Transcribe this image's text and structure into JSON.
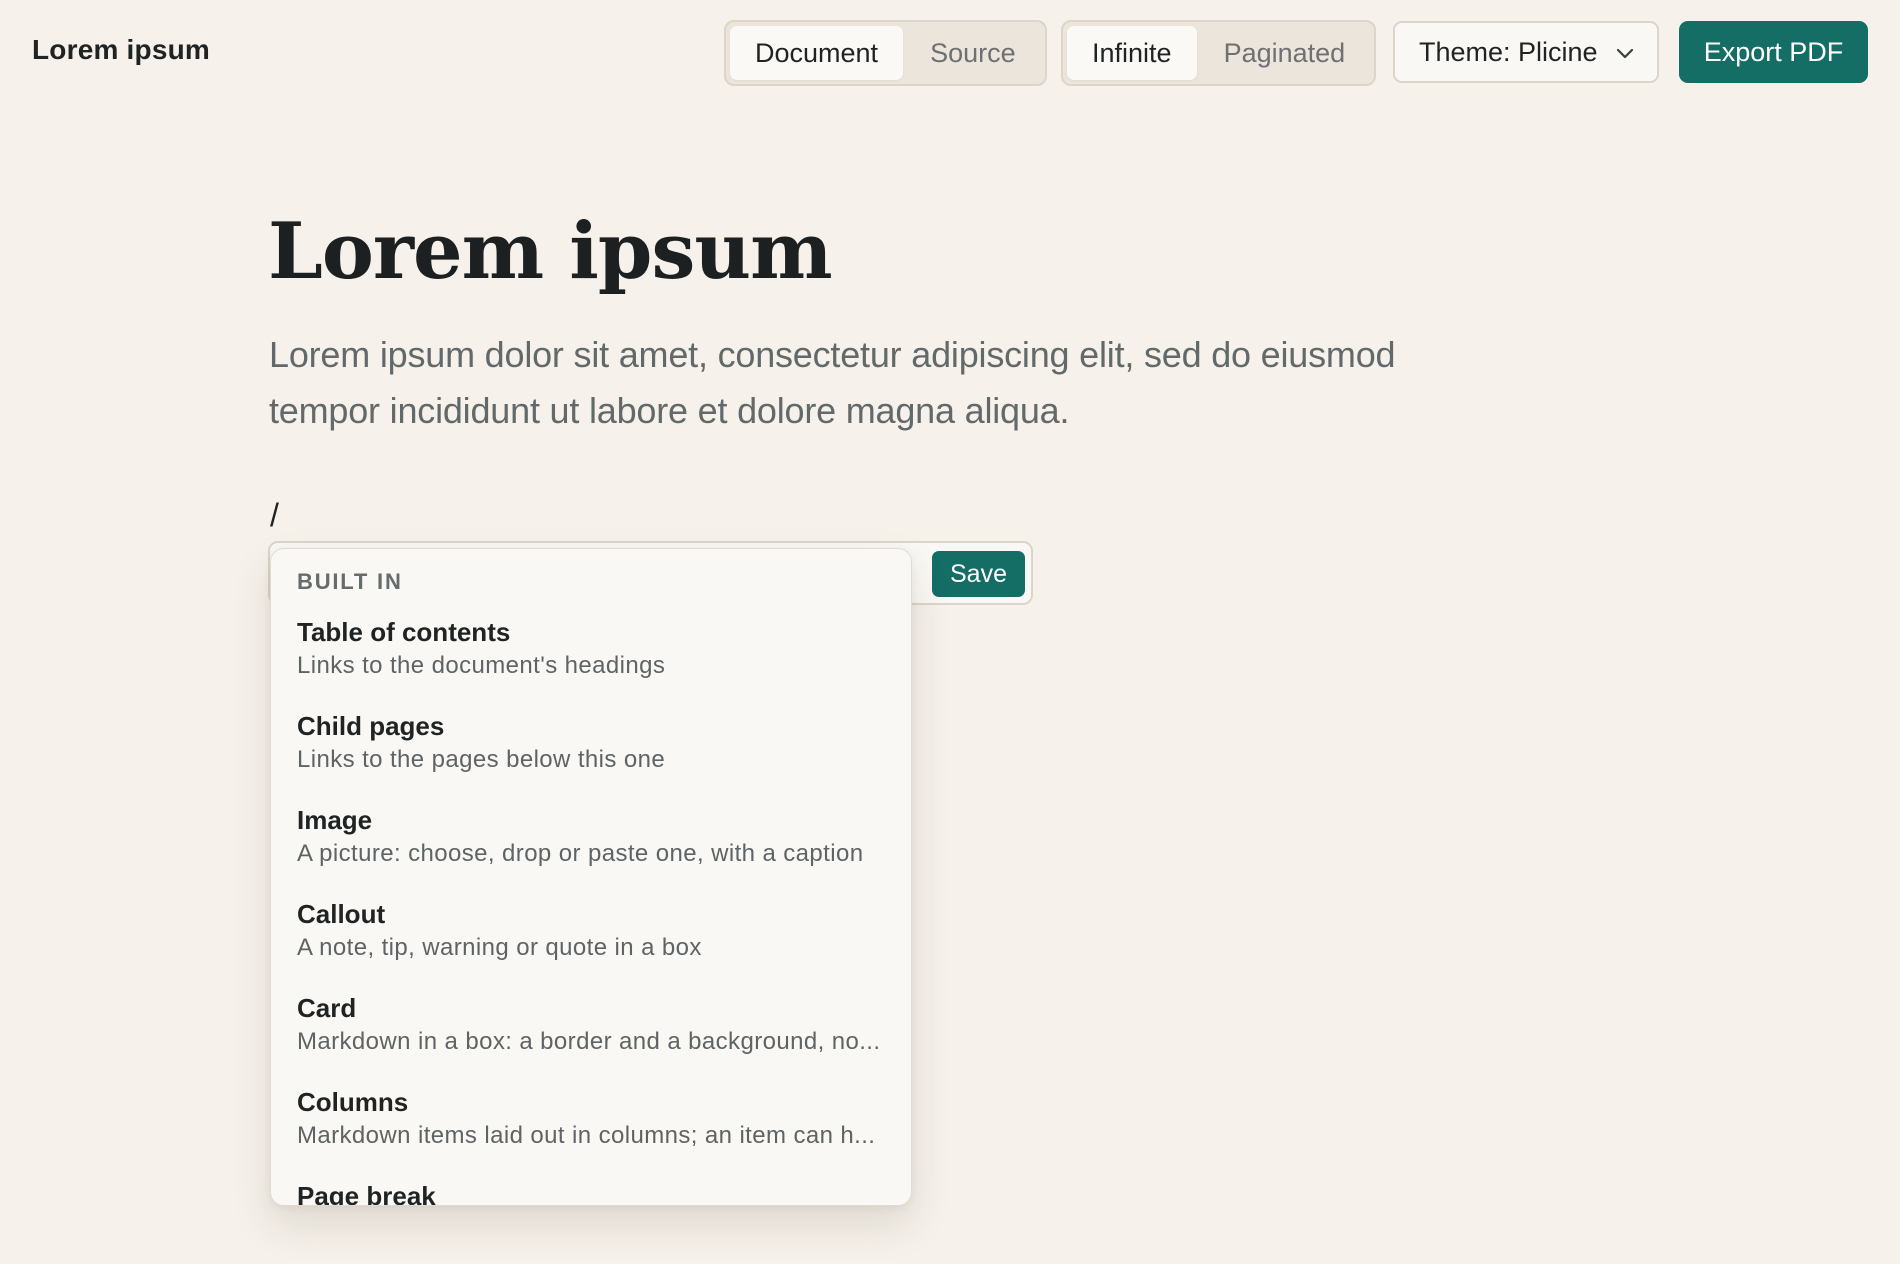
{
  "app": {
    "title": "Lorem ipsum"
  },
  "view_toggle": {
    "options": [
      "Document",
      "Source"
    ],
    "selected": "Document"
  },
  "layout_toggle": {
    "options": [
      "Infinite",
      "Paginated"
    ],
    "selected": "Infinite"
  },
  "theme": {
    "label": "Theme: Plicine",
    "icon": "chevron-down-icon"
  },
  "export": {
    "label": "Export PDF"
  },
  "document": {
    "title": "Lorem ipsum",
    "lead": "Lorem ipsum dolor sit amet, consectetur adipiscing elit, sed do eiusmod tempor incididunt ut labore et dolore magna aliqua.",
    "current_line": "/"
  },
  "command": {
    "save_label": "Save"
  },
  "menu": {
    "section_label": "BUILT IN",
    "items": [
      {
        "title": "Table of contents",
        "desc": "Links to the document's headings"
      },
      {
        "title": "Child pages",
        "desc": "Links to the pages below this one"
      },
      {
        "title": "Image",
        "desc": "A picture: choose, drop or paste one, with a caption"
      },
      {
        "title": "Callout",
        "desc": "A note, tip, warning or quote in a box"
      },
      {
        "title": "Card",
        "desc": "Markdown in a box: a border and a background, no..."
      },
      {
        "title": "Columns",
        "desc": "Markdown items laid out in columns; an item can h..."
      },
      {
        "title": "Page break",
        "desc": ""
      }
    ]
  },
  "colors": {
    "background": "#f6f1eb",
    "accent": "#146e66",
    "text": "#1f2324",
    "muted": "#62696a"
  }
}
